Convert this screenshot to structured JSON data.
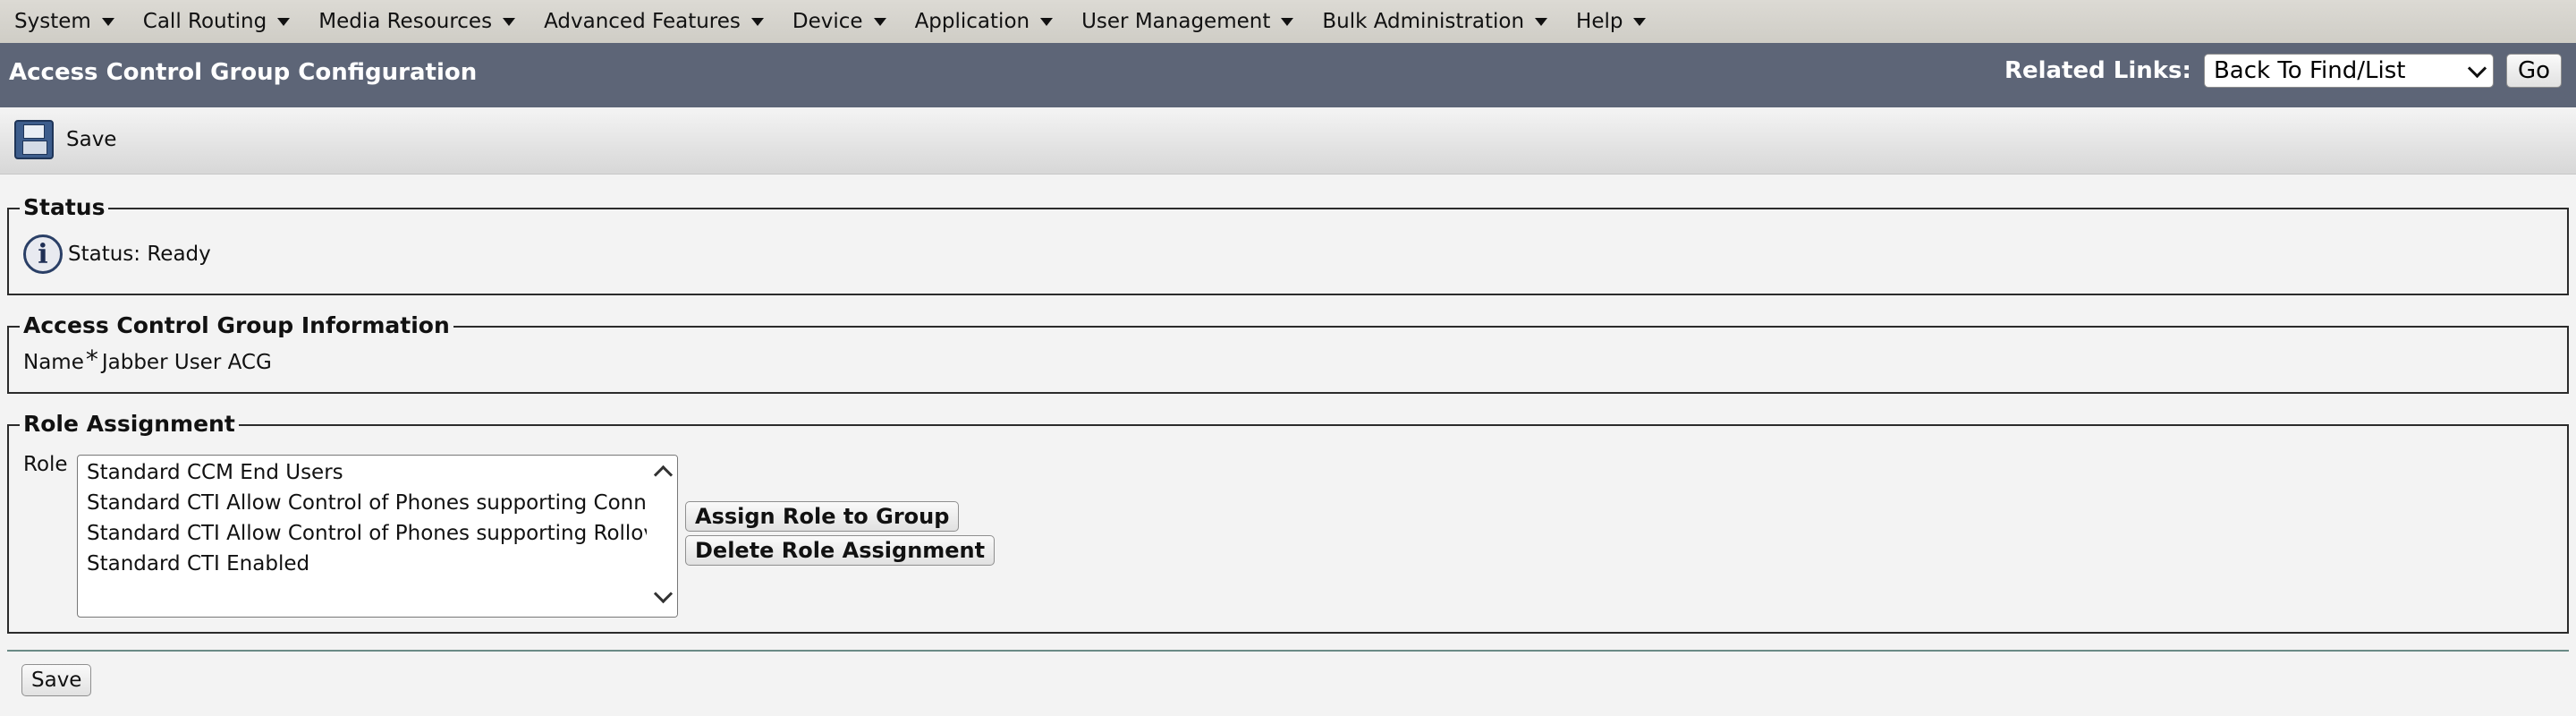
{
  "menu": [
    {
      "label": "System"
    },
    {
      "label": "Call Routing"
    },
    {
      "label": "Media Resources"
    },
    {
      "label": "Advanced Features"
    },
    {
      "label": "Device"
    },
    {
      "label": "Application"
    },
    {
      "label": "User Management"
    },
    {
      "label": "Bulk Administration"
    },
    {
      "label": "Help"
    }
  ],
  "header": {
    "title": "Access Control Group Configuration",
    "related_links_label": "Related Links:",
    "related_links_value": "Back To Find/List",
    "go_label": "Go"
  },
  "toolbar": {
    "save_label": "Save",
    "save_icon": "floppy-disk-icon"
  },
  "status": {
    "legend": "Status",
    "icon": "info-icon",
    "text": "Status: Ready"
  },
  "info": {
    "legend": "Access Control Group Information",
    "name_label": "Name",
    "required_mark": "*",
    "name_value": "Jabber User ACG"
  },
  "roles": {
    "legend": "Role Assignment",
    "label": "Role",
    "items": [
      {
        "label": "Standard CCM End Users"
      },
      {
        "label": "Standard CTI Allow Control of Phones supporting Connected Xfer and conf"
      },
      {
        "label": "Standard CTI Allow Control of Phones supporting Rollover Mode"
      },
      {
        "label": "Standard CTI Enabled"
      }
    ],
    "assign_label": "Assign Role to Group",
    "delete_label": "Delete Role Assignment"
  },
  "footer": {
    "save_label": "Save"
  }
}
